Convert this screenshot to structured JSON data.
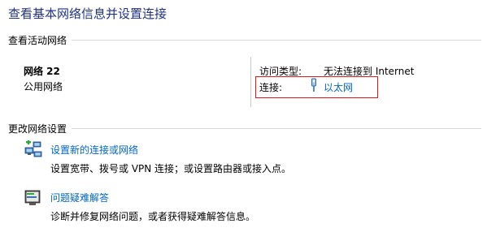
{
  "header": {
    "title": "查看基本网络信息并设置连接"
  },
  "active_networks": {
    "section_label": "查看活动网络",
    "network": {
      "name": "网络  22",
      "category": "公用网络"
    },
    "details": {
      "access_type_label": "访问类型:",
      "access_type_value": "无法连接到 Internet",
      "connection_label": "连接:",
      "connection_value": "以太网"
    },
    "highlight_color": "#e0181c"
  },
  "change_settings": {
    "section_label": "更改网络设置",
    "tasks": [
      {
        "label": "设置新的连接或网络",
        "description": "设置宽带、拨号或 VPN 连接；或设置路由器或接入点。",
        "icon": "network-setup-icon"
      },
      {
        "label": "问题疑难解答",
        "description": "诊断并修复网络问题，或者获得疑难解答信息。",
        "icon": "troubleshoot-icon"
      }
    ]
  },
  "colors": {
    "title": "#1e3287",
    "link": "#0066cc"
  }
}
